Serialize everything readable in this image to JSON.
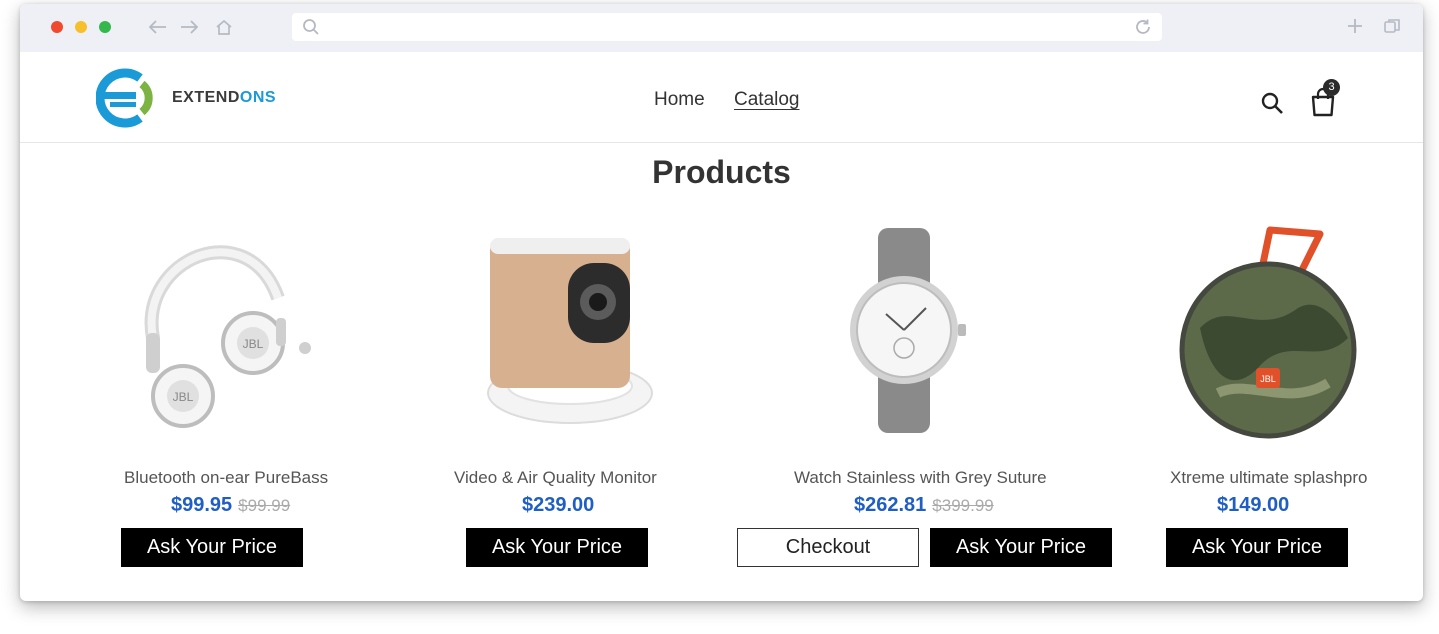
{
  "browser": {
    "url_value": "",
    "icons": [
      "back-arrow-icon",
      "forward-arrow-icon",
      "home-icon",
      "search-icon",
      "reload-icon",
      "new-tab-plus-icon",
      "duplicate-window-icon"
    ]
  },
  "brand": {
    "name_part1": "EXTEND",
    "name_part2": "ONS",
    "colors": {
      "blue": "#1a9ad6",
      "green": "#7cb342",
      "dark": "#3b3b3b"
    }
  },
  "nav": {
    "items": [
      {
        "label": "Home"
      },
      {
        "label": "Catalog",
        "active": true
      }
    ],
    "cart_count": "3"
  },
  "page": {
    "title": "Products"
  },
  "products": [
    {
      "name": "Bluetooth on-ear PureBass",
      "price": "$99.95",
      "old_price": "$99.99",
      "button": "Ask Your Price"
    },
    {
      "name": "Video & Air Quality Monitor",
      "price": "$239.00",
      "old_price": "",
      "button": "Ask Your Price"
    },
    {
      "name": "Watch Stainless with Grey Suture",
      "price": "$262.81",
      "old_price": "$399.99",
      "button": "Ask Your Price",
      "secondary_button": "Checkout"
    },
    {
      "name": "Xtreme ultimate splashpro",
      "price": "$149.00",
      "old_price": "",
      "button": "Ask Your Price"
    }
  ],
  "colors": {
    "price": "#1f5ec4",
    "button_bg": "#000000",
    "button_text": "#ffffff"
  }
}
